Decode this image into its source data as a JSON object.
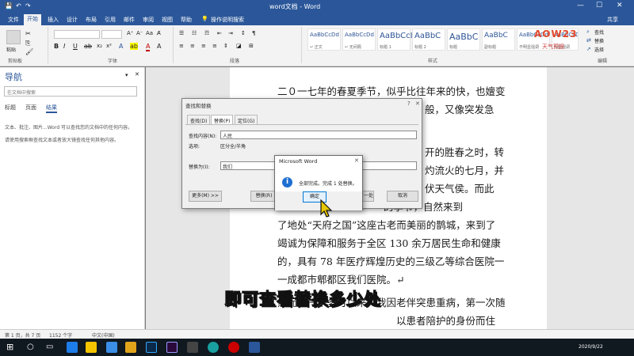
{
  "window": {
    "title": "word文档 - Word",
    "controls": [
      "—",
      "☐",
      "✕"
    ]
  },
  "ribbon_tabs": [
    "文件",
    "开始",
    "插入",
    "设计",
    "布局",
    "引用",
    "邮件",
    "审阅",
    "视图",
    "帮助"
  ],
  "tell_me": "操作说明搜索",
  "share": "共享",
  "ribbon": {
    "paste": "粘贴",
    "clipboard": "剪贴板",
    "font_group": "字体",
    "paragraph_group": "段落",
    "styles_group": "样式",
    "editing_group": "编辑",
    "find": "查找",
    "replace": "替换",
    "select": "选择",
    "styles": [
      {
        "preview": "AaBbCcDd",
        "label": "↵ 正文"
      },
      {
        "preview": "AaBbCcDd",
        "label": "↵ 无间隔"
      },
      {
        "preview": "AaBbCcI",
        "label": "标题 1"
      },
      {
        "preview": "AaBbC",
        "label": "标题 2"
      },
      {
        "preview": "AaBbC",
        "label": "标题"
      },
      {
        "preview": "AaBbC",
        "label": "副标题"
      },
      {
        "preview": "AaBbCcDd",
        "label": "不明显强调"
      },
      {
        "preview": "AaBbCcDd",
        "label": "明显强调"
      }
    ]
  },
  "logo": {
    "text": "AOW23",
    "sub": "天气预报"
  },
  "nav": {
    "title": "导航",
    "search_placeholder": "在文档中搜索",
    "tabs": [
      "标题",
      "页面",
      "结果"
    ],
    "hint1": "文本、批注、图片...Word 可以查找您的文档中的任何内容。",
    "hint2": "请使用搜索框查找文本或者放大镜查找任何其他内容。"
  },
  "document": {
    "paragraphs": [
      "二０一七年的春夏季节，似乎比往年来的快，也嬗变",
      "般，又像突发急",
      "开的胜春之时，转",
      "灼流火的七月，并",
      "伏天气侯。而此",
      "的季节，自然来到",
      "了地处“天府之国”这座古老而美丽的鹊城，来到了",
      "竭诚为保障和服务于全区 130 余万居民生命和健康",
      "的，具有 78 年医疗辉煌历史的三级乙等综合医院一",
      "一成都市郫都区我们医院。↵",
      "然而，一个多月以来，我因老伴突患重病，第一次随",
      "以患者陪护的身份而住"
    ]
  },
  "subtitle": "即可查看替换多少处",
  "find_replace": {
    "title": "查找和替换",
    "tabs": [
      "查找(D)",
      "替换(P)",
      "定位(G)"
    ],
    "find_label": "查找内容(N):",
    "find_value": "人民",
    "options_label": "选项:",
    "options_value": "区分全/半角",
    "replace_label": "替换为(I):",
    "replace_value": "我们",
    "more_btn": "更多(M) >>",
    "replace_btn": "替换(R)",
    "find_next_btn": "找下一处(F)",
    "cancel_btn": "取消"
  },
  "message_box": {
    "title": "Microsoft Word",
    "message": "全部完成。完成 1 处替换。",
    "ok": "确定"
  },
  "status": {
    "page": "第 1 页，共 7 页",
    "words": "1152 个字",
    "lang": "中文(中国)"
  },
  "taskbar": {
    "time": "2020/9/22"
  },
  "colors": {
    "accent": "#2b579a",
    "info": "#1f6fd0"
  }
}
